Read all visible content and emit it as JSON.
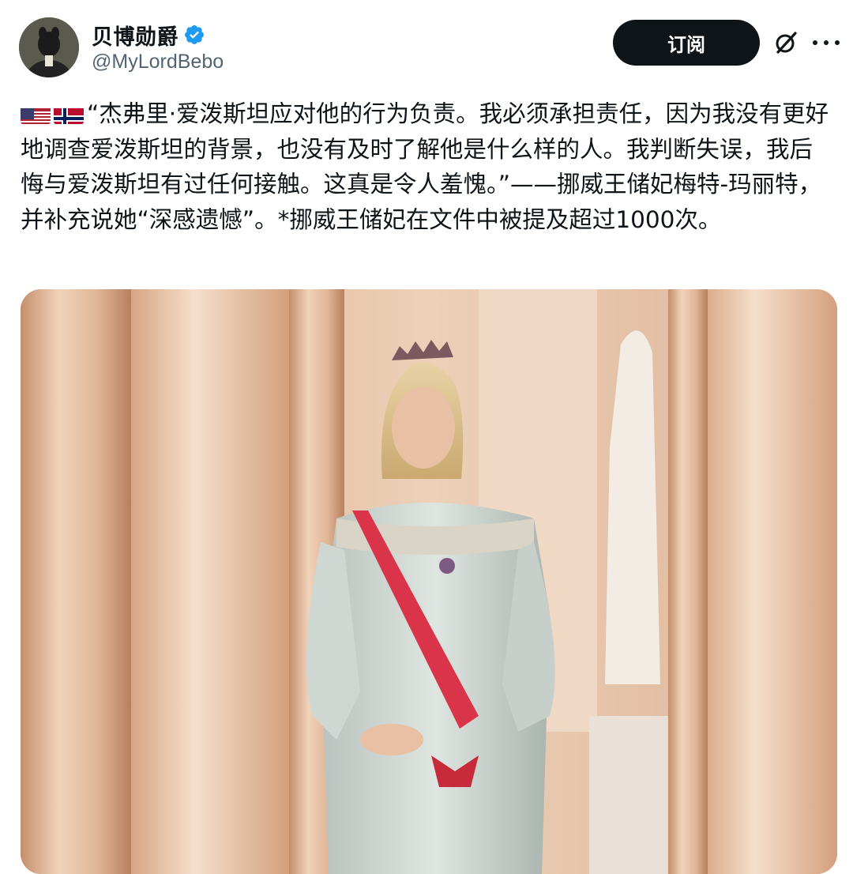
{
  "author": {
    "display_name": "贝博勋爵",
    "handle": "@MyLordBebo",
    "verified": true,
    "avatar_icon": "avatar-icon"
  },
  "actions": {
    "subscribe_label": "订阅",
    "grok_icon": "grok-icon",
    "more_icon": "more-icon"
  },
  "post": {
    "flags": [
      "us-flag-icon",
      "norway-flag-icon"
    ],
    "text": "“杰弗里·爱泼斯坦应对他的行为负责。我必须承担责任，因为我没有更好地调查爱泼斯坦的背景，也没有及时了解他是什么样的人。我判断失误，我后悔与爱泼斯坦有过任何接触。这真是令人羞愧。”——挪威王储妃梅特-玛丽特，并补充说她“深感遗憾”。*挪威王储妃在文件中被提及超过1000次。"
  },
  "colors": {
    "accent": "#1d9bf0",
    "text_primary": "#0f1419",
    "text_secondary": "#536471",
    "button_bg": "#0f1419",
    "button_text": "#ffffff"
  }
}
